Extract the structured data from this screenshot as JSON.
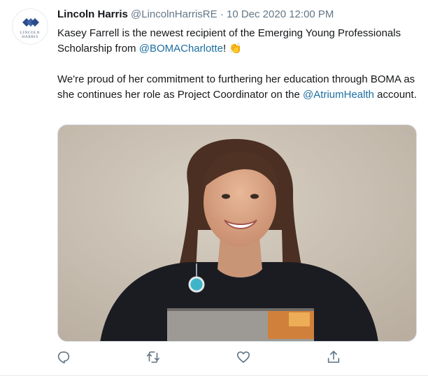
{
  "tweet": {
    "author_name": "Lincoln Harris",
    "handle": "@LincolnHarrisRE",
    "separator": "·",
    "timestamp": "10 Dec 2020 12:00 PM",
    "avatar_text": {
      "line1": "LINCOLN",
      "line2": "HARRIS"
    },
    "paragraph1": {
      "before": "Kasey Farrell is the newest recipient of the Emerging Young Professionals Scholarship from ",
      "mention": "@BOMACharlotte",
      "after": "!",
      "emoji": "👏"
    },
    "paragraph2": {
      "before": "We're proud of her commitment to furthering her education through BOMA as she continues her role as Project Coordinator on the ",
      "mention": "@AtriumHealth",
      "after": " account."
    },
    "photo": {
      "alt": ""
    }
  },
  "actions": [
    {
      "name": "reply",
      "icon": "reply-icon"
    },
    {
      "name": "retweet",
      "icon": "retweet-icon"
    },
    {
      "name": "like",
      "icon": "like-icon"
    },
    {
      "name": "share",
      "icon": "share-icon"
    }
  ],
  "colors": {
    "link": "#1b6fa0",
    "muted": "#657786",
    "icon": "#657786",
    "logo_blue": "#2b4b8c"
  }
}
